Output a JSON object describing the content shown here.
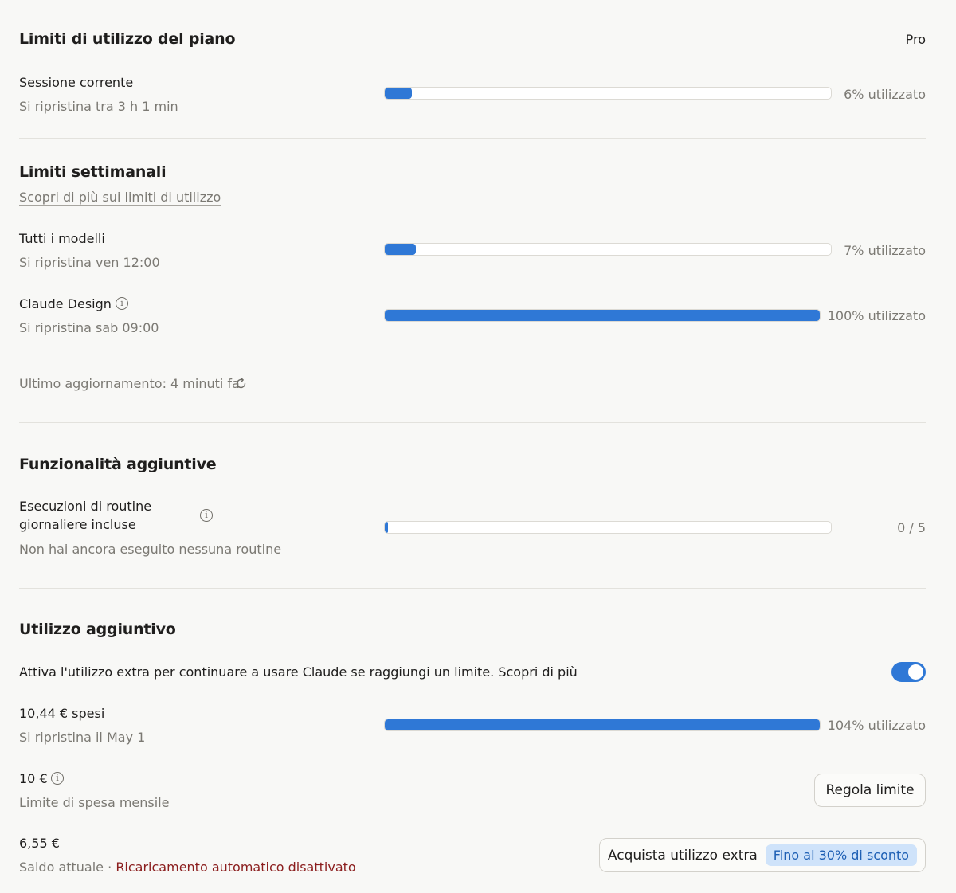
{
  "plan": {
    "title": "Limiti di utilizzo del piano",
    "badge": "Pro",
    "session": {
      "label": "Sessione corrente",
      "reset": "Si ripristina tra 3 h 1 min",
      "usage_text": "6% utilizzato",
      "usage": 0.06
    }
  },
  "weekly": {
    "title": "Limiti settimanali",
    "learn_more": "Scopri di più sui limiti di utilizzo",
    "all_models": {
      "label": "Tutti i modelli",
      "reset": "Si ripristina ven 12:00",
      "usage_text": "7% utilizzato",
      "usage": 0.07
    },
    "claude_design": {
      "label": "Claude Design",
      "reset": "Si ripristina sab 09:00",
      "usage_text": "100% utilizzato",
      "usage": 1.0
    },
    "last_update": "Ultimo aggiornamento: 4 minuti fa"
  },
  "features": {
    "title": "Funzionalità aggiuntive",
    "routines": {
      "label_line1": "Esecuzioni di routine",
      "label_line2": "giornaliere incluse",
      "sub": "Non hai ancora eseguito nessuna routine",
      "count_text": "0 / 5",
      "used": 0,
      "total": 5
    }
  },
  "extra": {
    "title": "Utilizzo aggiuntivo",
    "description": "Attiva l'utilizzo extra per continuare a usare Claude se raggiungi un limite.",
    "learn_more": "Scopri di più",
    "toggle_on": true,
    "spent": {
      "label": "10,44 € spesi",
      "reset": "Si ripristina il May 1",
      "usage_text": "104% utilizzato",
      "usage": 1.04
    },
    "limit": {
      "label": "10 €",
      "sub": "Limite di spesa mensile",
      "button": "Regola limite"
    },
    "balance": {
      "label": "6,55 €",
      "sub": "Saldo attuale",
      "separator": "·",
      "auto_reload": "Ricaricamento automatico disattivato",
      "buy_button": "Acquista utilizzo extra",
      "discount": "Fino al 30% di sconto"
    }
  },
  "colors": {
    "accent": "#2f78d6",
    "muted_text": "#7b7973",
    "danger_link": "#8b1e1e",
    "badge_bg": "#cfe3fa"
  },
  "icons": {
    "info": "info-icon",
    "refresh": "refresh-icon"
  }
}
